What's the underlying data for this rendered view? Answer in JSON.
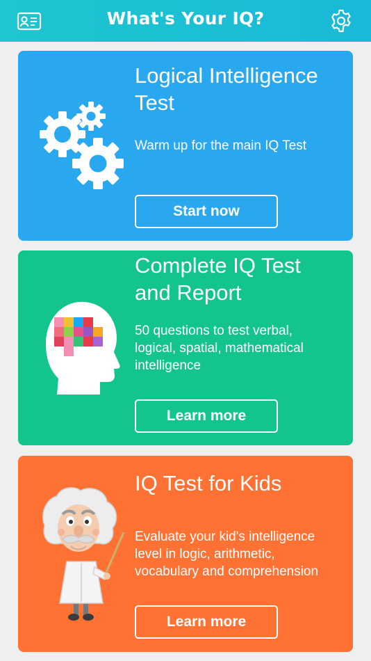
{
  "header": {
    "title": "What's Your IQ?",
    "profile_icon": "id-card-icon",
    "settings_icon": "gear-icon"
  },
  "cards": [
    {
      "title_line1": "Logical Intelligence",
      "title_line2": "Test",
      "description": "Warm up for the main IQ Test",
      "button": "Start now",
      "color": "#2aa8ef",
      "illustration": "gears-icon"
    },
    {
      "title_line1": "Complete IQ Test",
      "title_line2": "and Report",
      "desc_line1": "50 questions to test verbal,",
      "desc_line2": "logical, spatial, mathematical",
      "desc_line3": "intelligence",
      "button": "Learn more",
      "color": "#13c58d",
      "illustration": "head-brain-icon"
    },
    {
      "title_line1": "IQ Test for Kids",
      "desc_line1": "Evaluate your kid's intelligence",
      "desc_line2": "level in logic, arithmetic,",
      "desc_line3": "vocabulary and comprehension",
      "button": "Learn more",
      "color": "#ff7233",
      "illustration": "scientist-mascot"
    }
  ]
}
